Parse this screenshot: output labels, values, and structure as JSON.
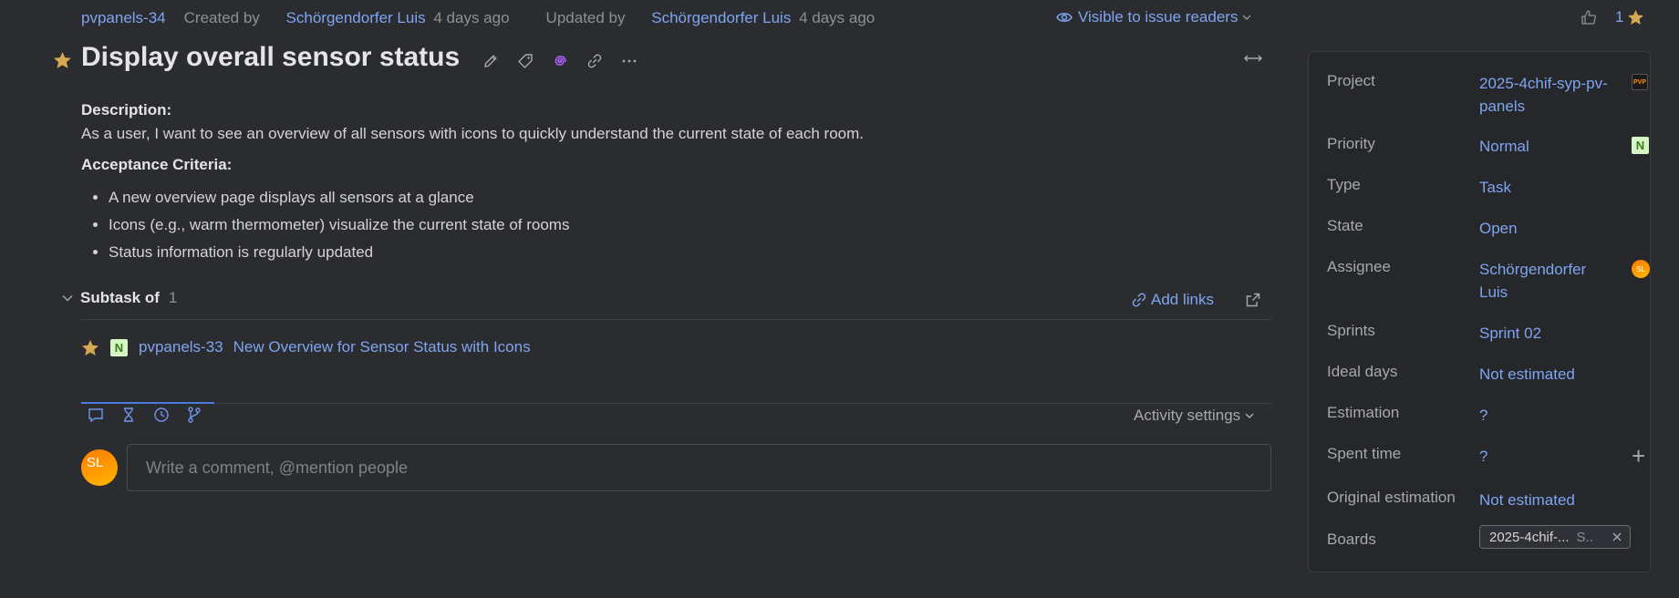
{
  "meta": {
    "issue_id": "pvpanels-34",
    "created_prefix": "Created by",
    "created_by": "Schörgendorfer Luis",
    "created_when": "4 days ago",
    "updated_prefix": "Updated by",
    "updated_by": "Schörgendorfer Luis",
    "updated_when": "4 days ago",
    "visibility": "Visible to issue readers",
    "vote_count": "1"
  },
  "title": "Display overall sensor status",
  "icons": {
    "title_star": "star-icon",
    "edit": "pencil-icon",
    "tag": "tag-icon",
    "ai": "spiral-icon",
    "link": "link-icon",
    "more": "ellipsis-icon",
    "expand": "expand-horizontal-icon"
  },
  "description": {
    "heading": "Description:",
    "text": "As a user, I want to see an overview of all sensors with icons to quickly understand the current state of each room.",
    "criteria_heading": "Acceptance Criteria:",
    "criteria": [
      "A new overview page displays all sensors at a glance",
      "Icons (e.g., warm thermometer) visualize the current state of rooms",
      "Status information is regularly updated"
    ]
  },
  "subtask": {
    "label": "Subtask of",
    "count": "1",
    "add_links": "Add links",
    "item_badge": "N",
    "item_id": "pvpanels-33",
    "item_summary": "New Overview for Sensor Status with Icons"
  },
  "activity": {
    "settings_label": "Activity settings",
    "comment_placeholder": "Write a comment, @mention people",
    "avatar_initials": "SL"
  },
  "fields": {
    "project_label": "Project",
    "project_value": "2025-4chif-syp-pv-panels",
    "priority_label": "Priority",
    "priority_value": "Normal",
    "priority_badge": "N",
    "type_label": "Type",
    "type_value": "Task",
    "state_label": "State",
    "state_value": "Open",
    "assignee_label": "Assignee",
    "assignee_value": "Schörgendorfer Luis",
    "assignee_initials": "SL",
    "sprints_label": "Sprints",
    "sprints_value": "Sprint 02",
    "ideal_days_label": "Ideal days",
    "ideal_days_value": "Not estimated",
    "estimation_label": "Estimation",
    "estimation_value": "?",
    "spent_time_label": "Spent time",
    "spent_time_value": "?",
    "original_estimation_label": "Original estimation",
    "original_estimation_value": "Not estimated",
    "boards_label": "Boards",
    "board_chip": "2025-4chif-...",
    "board_chip_suffix": "S.."
  },
  "colors": {
    "background": "#2b2c30",
    "link": "#7fa4f0",
    "star": "#d7a852",
    "accent": "#4b7be0",
    "priority_badge_bg": "#d6f5c4"
  }
}
